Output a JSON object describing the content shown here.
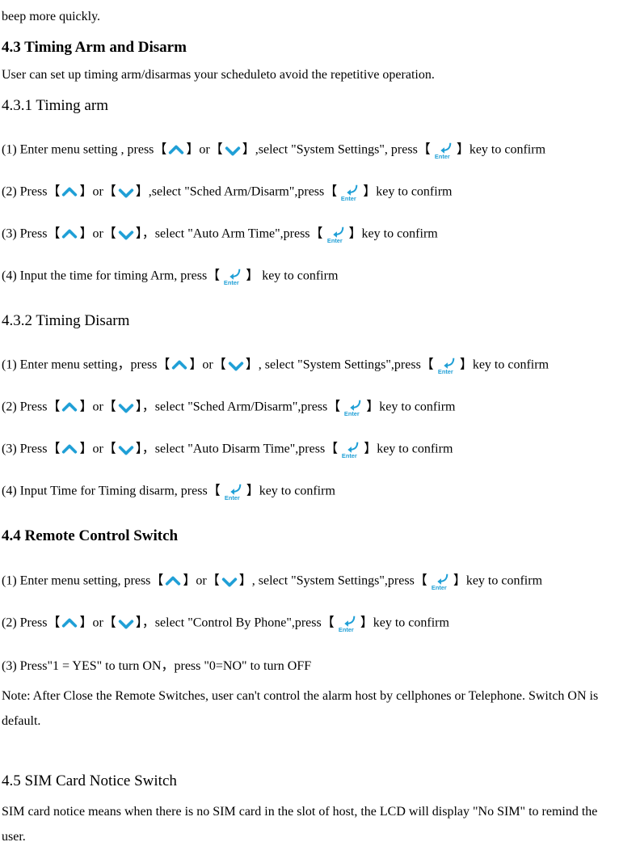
{
  "intro_fragment": "beep more quickly.",
  "s43": {
    "heading": "4.3 Timing Arm and Disarm",
    "desc": "User can set up timing arm/disarmas your scheduleto avoid the repetitive operation."
  },
  "s431": {
    "heading": "4.3.1 Timing arm",
    "step1_a": "(1) Enter menu setting , press【",
    "step1_b": "】or【",
    "step1_c": "】,select \"System Settings\", press【",
    "step1_d": "】key to confirm",
    "step2_a": "(2) Press【",
    "step2_b": "】or【",
    "step2_c": "】,select \"Sched Arm/Disarm\",press【",
    "step2_d": "】key to confirm",
    "step3_a": "(3) Press【",
    "step3_b": "】or【",
    "step3_c": "】，select \"Auto Arm Time\",press【",
    "step3_d": "】key to confirm",
    "step4_a": "(4) Input the time for timing Arm, press【",
    "step4_b": "】  key to confirm"
  },
  "s432": {
    "heading": "4.3.2 Timing Disarm",
    "step1_a": "(1) Enter menu setting，press【",
    "step1_b": "】or【",
    "step1_c": "】, select \"System Settings\",press【",
    "step1_d": "】key to confirm",
    "step2_a": "(2) Press【",
    "step2_b": "】or【",
    "step2_c": "】，select \"Sched Arm/Disarm\",press【",
    "step2_d": "】key to confirm",
    "step3_a": "(3) Press【",
    "step3_b": "】or【",
    "step3_c": "】，select \"Auto Disarm Time\",press【",
    "step3_d": "】key to confirm",
    "step4_a": "(4) Input Time for Timing disarm, press【",
    "step4_b": "】key to confirm"
  },
  "s44": {
    "heading": "4.4 Remote Control Switch",
    "step1_a": "(1) Enter menu setting, press【",
    "step1_b": "】or【",
    "step1_c": "】, select \"System Settings\",press【",
    "step1_d": "】key to confirm",
    "step2_a": "(2) Press【",
    "step2_b": "】or【",
    "step2_c": "】，select \"Control By Phone\",press【",
    "step2_d": "】key to confirm",
    "step3": "(3) Press\"1 = YES\" to turn ON，press \"0=NO\" to turn OFF",
    "note": "Note: After Close the Remote Switches, user can't control the alarm host by cellphones or Telephone. Switch ON is default."
  },
  "s45": {
    "heading": "4.5 SIM Card Notice Switch",
    "desc": "SIM card notice means when there is no SIM card in the slot of host, the LCD will display \"No SIM\" to remind the user."
  },
  "icons": {
    "up": "up-arrow-icon",
    "down": "down-arrow-icon",
    "enter": "enter-icon",
    "enter_text": "Enter"
  }
}
